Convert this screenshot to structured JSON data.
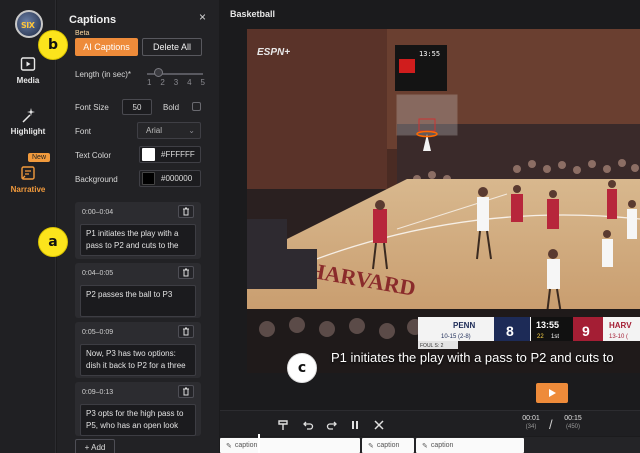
{
  "nav": {
    "logo_text": "SIX",
    "items": [
      {
        "label": "Media"
      },
      {
        "label": "Highlight"
      },
      {
        "label": "Narrative",
        "badge": "New"
      }
    ]
  },
  "panel": {
    "title": "Captions",
    "close": "×",
    "beta_label": "Beta",
    "ai_button": "AI Captions",
    "delete_button": "Delete All",
    "length_label": "Length (in sec)*",
    "length_ticks": [
      "1",
      "2",
      "3",
      "4",
      "5"
    ],
    "length_value": 2,
    "font_size_label": "Font Size",
    "font_size_value": "50",
    "bold_label": "Bold",
    "bold_checked": false,
    "font_label": "Font",
    "font_value": "Arial",
    "text_color_label": "Text Color",
    "text_color_value": "#FFFFFF",
    "background_label": "Background",
    "background_value": "#000000",
    "captions": [
      {
        "time": "0:00–0:04",
        "text": "P1 initiates the play with a pass to P2 and cuts to the"
      },
      {
        "time": "0:04–0:05",
        "text": "P2 passes the ball to P3"
      },
      {
        "time": "0:05–0:09",
        "text": "Now, P3 has two options: dish it back to P2 for a three"
      },
      {
        "time": "0:09–0:13",
        "text": "P3 opts for the high pass to P5, who has an open look"
      }
    ],
    "add_button": "+ Add"
  },
  "main": {
    "title": "Basketball",
    "caption_overlay": "P1 initiates the play with a pass to P2 and cuts to",
    "scoreboard": {
      "home_team": "PENN",
      "home_record": "10-15 (2-8)",
      "home_score": "8",
      "clock": "13:55",
      "shot_clock": "22",
      "period": "1st",
      "away_score": "9",
      "away_team": "HARV",
      "away_record": "13-10 (",
      "fouls": "FOUL S: 2"
    },
    "network": "ESPN+",
    "court_text": "HARVARD",
    "arena_clock": "13:55",
    "current_time": "00:01",
    "current_frames": "(34)",
    "total_time": "00:15",
    "total_frames": "(450)",
    "timeline_clips": [
      {
        "label": "caption"
      },
      {
        "label": "caption"
      },
      {
        "label": "caption"
      }
    ]
  },
  "markers": {
    "a": "a",
    "b": "b",
    "c": "c"
  },
  "colors": {
    "accent": "#ee8b3a",
    "panel_bg": "#222225",
    "marker": "#fce41c"
  }
}
